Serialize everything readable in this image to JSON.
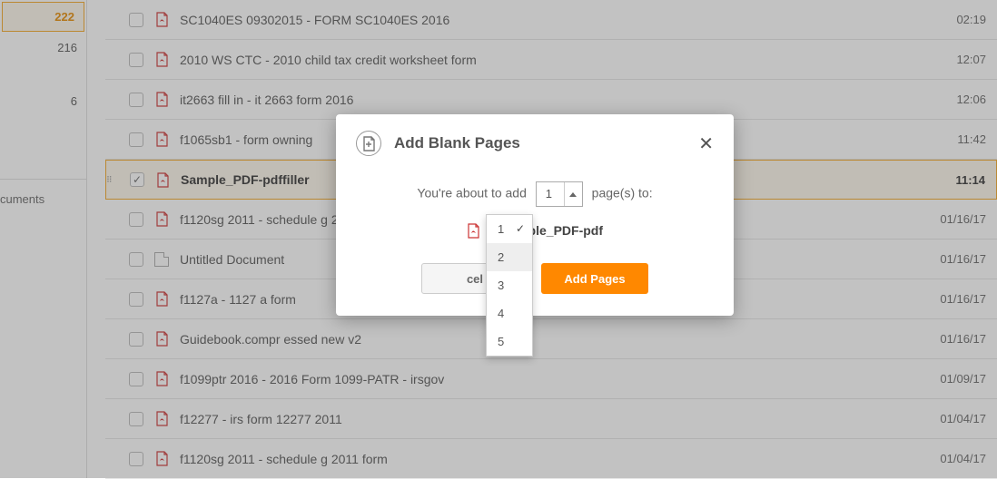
{
  "sidebar": {
    "items": [
      "222",
      "216",
      "6",
      ""
    ],
    "docs_label": "cuments"
  },
  "files": [
    {
      "name": "SC1040ES 09302015 - FORM SC1040ES 2016",
      "time": "02:19",
      "type": "pdf",
      "checked": false
    },
    {
      "name": "2010 WS CTC - 2010 child tax credit worksheet form",
      "time": "12:07",
      "type": "pdf",
      "checked": false
    },
    {
      "name": "it2663 fill in - it 2663 form 2016",
      "time": "12:06",
      "type": "pdf",
      "checked": false
    },
    {
      "name": "f1065sb1 - form owning",
      "time": "11:42",
      "type": "pdf",
      "checked": false
    },
    {
      "name": "Sample_PDF-pdffiller",
      "time": "11:14",
      "type": "pdf",
      "checked": true
    },
    {
      "name": "f1120sg 2011 - schedule g 2011",
      "time": "01/16/17",
      "type": "pdf",
      "checked": false
    },
    {
      "name": "Untitled Document",
      "time": "01/16/17",
      "type": "doc",
      "checked": false
    },
    {
      "name": "f1127a - 1127 a form",
      "time": "01/16/17",
      "type": "pdf",
      "checked": false
    },
    {
      "name": "Guidebook.compr essed new v2",
      "time": "01/16/17",
      "type": "pdf",
      "checked": false
    },
    {
      "name": "f1099ptr 2016 - 2016 Form 1099-PATR - irsgov",
      "time": "01/09/17",
      "type": "pdf",
      "checked": false
    },
    {
      "name": "f12277 - irs form 12277 2011",
      "time": "01/04/17",
      "type": "pdf",
      "checked": false
    },
    {
      "name": "f1120sg 2011 - schedule g 2011 form",
      "time": "01/04/17",
      "type": "pdf",
      "checked": false
    }
  ],
  "modal": {
    "title": "Add Blank Pages",
    "text_before": "You're about to add",
    "text_after": "page(s) to:",
    "selected": "1",
    "filename": "Sample_PDF-pdf",
    "cancel": "cel",
    "add": "Add Pages"
  },
  "dropdown": {
    "options": [
      "1",
      "2",
      "3",
      "4",
      "5"
    ],
    "selected_index": 0,
    "hover_index": 1
  }
}
